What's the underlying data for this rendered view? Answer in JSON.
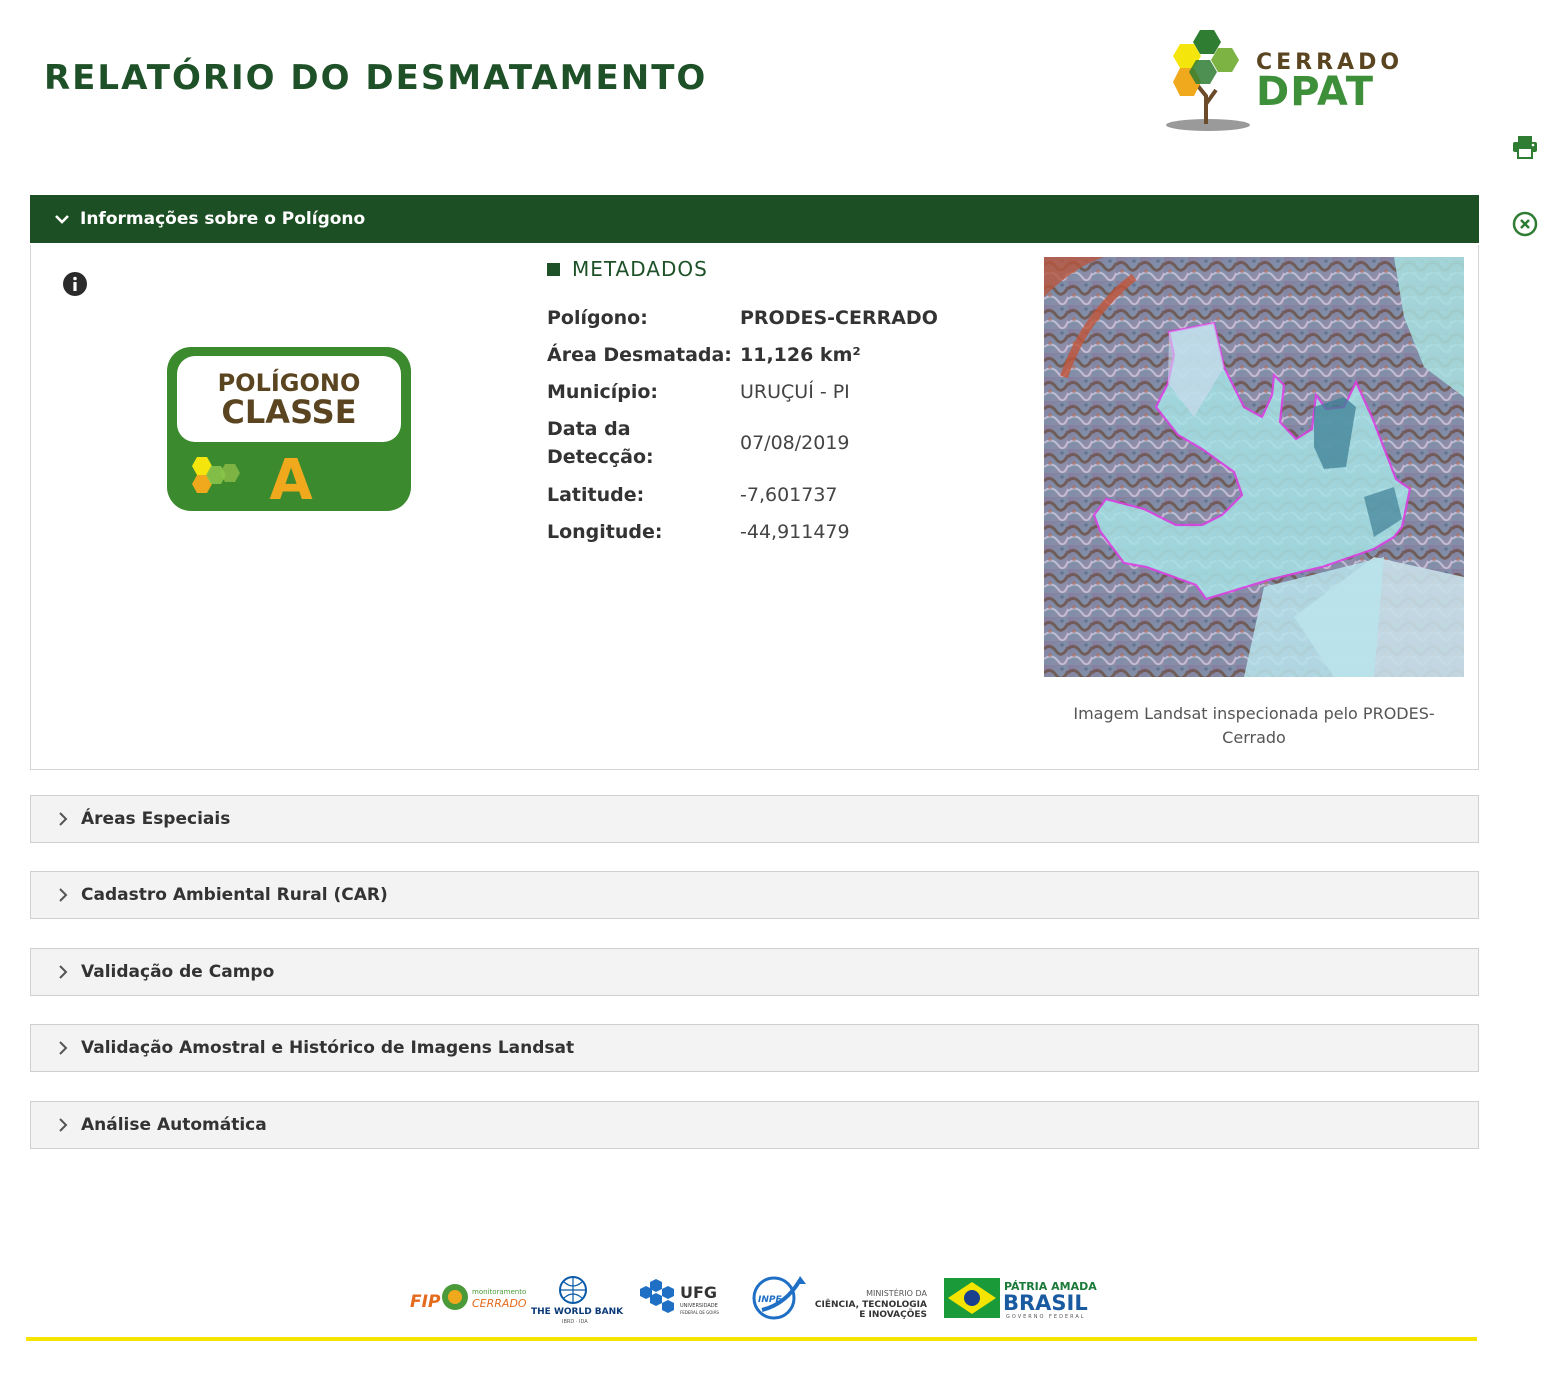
{
  "header": {
    "title": "RELATÓRIO DO DESMATAMENTO",
    "logo": {
      "small": "CERRADO",
      "big": "DPAT"
    }
  },
  "actions": {
    "print_icon": "printer-icon",
    "close_icon": "close-circle-icon"
  },
  "polygon_section": {
    "label": "Informações sobre o Polígono",
    "expanded": true,
    "badge": {
      "line1": "POLÍGONO",
      "line2": "CLASSE",
      "class": "A"
    },
    "metadata_heading": "METADADOS",
    "metadata": [
      {
        "key": "Polígono:",
        "value": "PRODES-CERRADO",
        "bold": true
      },
      {
        "key": "Área Desmatada:",
        "value": "11,126 km²",
        "bold": true
      },
      {
        "key": "Município:",
        "value": "URUÇUÍ - PI",
        "bold": false
      },
      {
        "key": "Data da Detecção:",
        "value": "07/08/2019",
        "bold": false
      },
      {
        "key": "Latitude:",
        "value": "-7,601737",
        "bold": false
      },
      {
        "key": "Longitude:",
        "value": "-44,911479",
        "bold": false
      }
    ],
    "image_caption": "Imagem Landsat inspecionada pelo PRODES-Cerrado"
  },
  "sections": [
    {
      "label": "Áreas Especiais"
    },
    {
      "label": "Cadastro Ambiental Rural (CAR)"
    },
    {
      "label": "Validação de Campo"
    },
    {
      "label": "Validação Amostral e Histórico de Imagens Landsat"
    },
    {
      "label": "Análise Automática"
    }
  ],
  "footer": {
    "logos": {
      "fip": "FIP",
      "fip_sub1": "monitoramento",
      "fip_sub2": "CERRADO",
      "worldbank": "THE WORLD BANK",
      "worldbank_sub": "IBRD · IDA",
      "ufg": "UFG",
      "ufg_sub1": "UNIVERSIDADE",
      "ufg_sub2": "FEDERAL DE GOIÁS",
      "inpe": "INPE",
      "mcti1": "MINISTÉRIO DA",
      "mcti2": "CIÊNCIA, TECNOLOGIA",
      "mcti3": "E INOVAÇÕES",
      "brasil1": "PÁTRIA AMADA",
      "brasil2": "BRASIL",
      "brasil3": "GOVERNO FEDERAL"
    }
  },
  "colors": {
    "primary_green": "#1d4f24",
    "accent_yellow": "#f5e400",
    "polygon_outline": "#e040e8"
  }
}
